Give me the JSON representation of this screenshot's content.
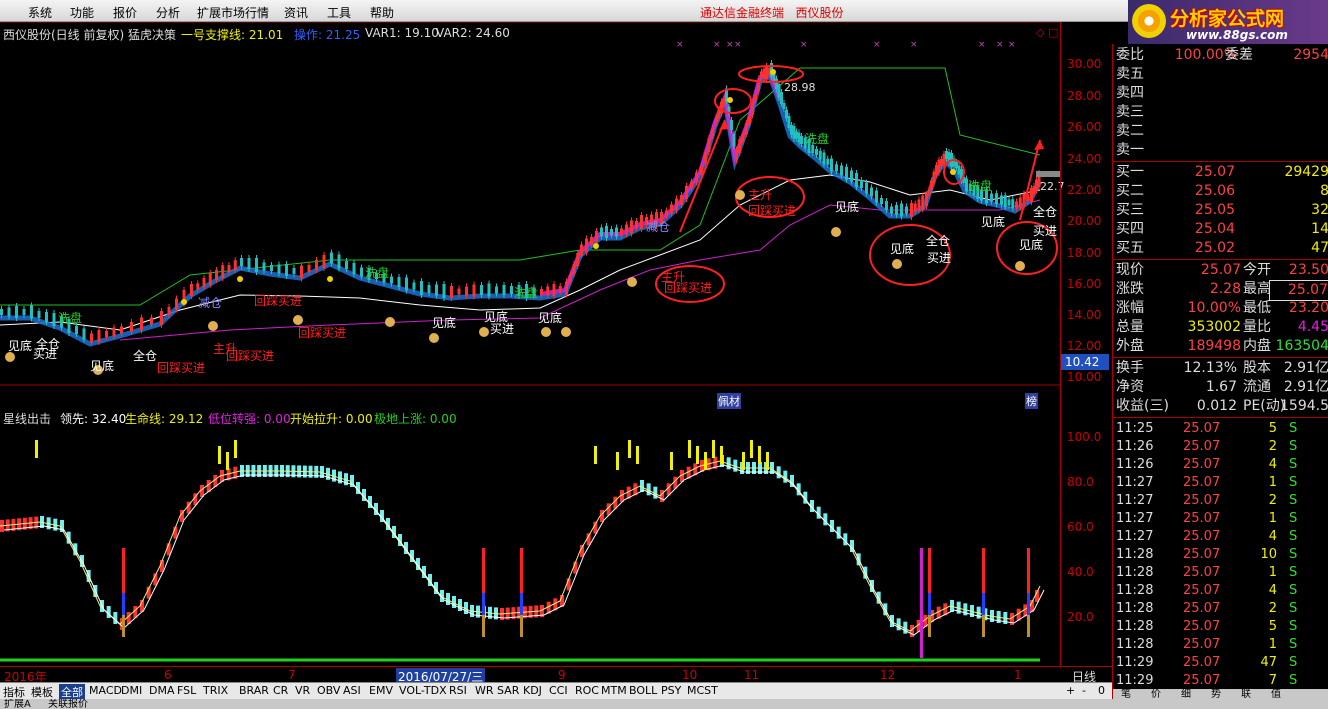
{
  "menu": [
    "系统",
    "功能",
    "报价",
    "分析",
    "扩展市场行情",
    "资讯",
    "工具",
    "帮助"
  ],
  "app_title": "通达信金融终端",
  "stock_name_header": "西仪股份",
  "brand": {
    "name": "分析家公式网",
    "url": "www.88gs.com"
  },
  "upper": {
    "title": "西仪股份(日线 前复权) 猛虎决策",
    "support_label": "一号支撑线: 21.01",
    "op_label": "操作: 21.25",
    "var1": "VAR1: 19.10",
    "var2": "VAR2: 24.60",
    "peak_label": "28.98",
    "right_tag": "22.7",
    "price_tag": "10.42",
    "marker1": "佩材",
    "marker2": "榜"
  },
  "lower": {
    "title": "星线出击",
    "l1": "领先: 32.40",
    "l2": "生命线: 29.12",
    "l3": "低位转强: 0.00",
    "l4": "开始拉升: 0.00",
    "l5": "极地上涨: 0.00"
  },
  "annotations": {
    "xipan": "洗盘",
    "jiandi": "见底",
    "quancang": "全仓",
    "mairu": "买进",
    "huicai": "回踩买进",
    "zhusheng": "主升",
    "jiancang": "减仓"
  },
  "upper_ticks": [
    "30.00",
    "28.00",
    "26.00",
    "24.00",
    "22.00",
    "20.00",
    "18.00",
    "16.00",
    "14.00",
    "12.00",
    "10.00"
  ],
  "lower_ticks": [
    "100.0",
    "80.0",
    "60.0",
    "40.0",
    "20.0"
  ],
  "dates": [
    "2016年",
    "6",
    "7",
    "2016/07/27/三",
    "9",
    "10",
    "11",
    "12",
    "1"
  ],
  "period": "日线",
  "tabs": [
    "指标",
    "模板",
    "全部",
    "MACD",
    "DMI",
    "DMA",
    "FSL",
    "TRIX",
    "BRAR",
    "CR",
    "VR",
    "OBV",
    "ASI",
    "EMV",
    "VOL-TDX",
    "RSI",
    "WR",
    "SAR",
    "KDJ",
    "CCI",
    "ROC",
    "MTM",
    "BOLL",
    "PSY",
    "MCST"
  ],
  "zoom_controls": [
    "+",
    "-",
    "0"
  ],
  "status_items": [
    "扩展A",
    "关联报价"
  ],
  "quote": {
    "top": {
      "label": "委比",
      "value": "100.00%",
      "label2": "委差",
      "value2": "2954"
    },
    "sells": [
      "卖五",
      "卖四",
      "卖三",
      "卖二",
      "卖一"
    ],
    "buys": [
      {
        "label": "买一",
        "price": "25.07",
        "vol": "29429"
      },
      {
        "label": "买二",
        "price": "25.06",
        "vol": "8"
      },
      {
        "label": "买三",
        "price": "25.05",
        "vol": "32"
      },
      {
        "label": "买四",
        "price": "25.04",
        "vol": "14"
      },
      {
        "label": "买五",
        "price": "25.02",
        "vol": "47"
      }
    ],
    "stats": [
      {
        "l": "现价",
        "v": "25.07",
        "l2": "今开",
        "v2": "23.50"
      },
      {
        "l": "涨跌",
        "v": "2.28",
        "l2": "最高",
        "v2": "25.07"
      },
      {
        "l": "涨幅",
        "v": "10.00%",
        "l2": "最低",
        "v2": "23.20"
      },
      {
        "l": "总量",
        "v": "353002",
        "l2": "量比",
        "v2": "4.45"
      },
      {
        "l": "外盘",
        "v": "189498",
        "l2": "内盘",
        "v2": "163504"
      }
    ],
    "stats2": [
      {
        "l": "换手",
        "v": "12.13%",
        "l2": "股本",
        "v2": "2.91亿"
      },
      {
        "l": "净资",
        "v": "1.67",
        "l2": "流通",
        "v2": "2.91亿"
      },
      {
        "l": "收益(三)",
        "v": "0.012",
        "l2": "PE(动)",
        "v2": "1594.5"
      }
    ],
    "ticks": [
      {
        "t": "11:25",
        "p": "25.07",
        "v": "5",
        "s": "S"
      },
      {
        "t": "11:26",
        "p": "25.07",
        "v": "2",
        "s": "S"
      },
      {
        "t": "11:26",
        "p": "25.07",
        "v": "4",
        "s": "S"
      },
      {
        "t": "11:27",
        "p": "25.07",
        "v": "1",
        "s": "S"
      },
      {
        "t": "11:27",
        "p": "25.07",
        "v": "2",
        "s": "S"
      },
      {
        "t": "11:27",
        "p": "25.07",
        "v": "1",
        "s": "S"
      },
      {
        "t": "11:27",
        "p": "25.07",
        "v": "4",
        "s": "S"
      },
      {
        "t": "11:28",
        "p": "25.07",
        "v": "10",
        "s": "S"
      },
      {
        "t": "11:28",
        "p": "25.07",
        "v": "1",
        "s": "S"
      },
      {
        "t": "11:28",
        "p": "25.07",
        "v": "4",
        "s": "S"
      },
      {
        "t": "11:28",
        "p": "25.07",
        "v": "2",
        "s": "S"
      },
      {
        "t": "11:28",
        "p": "25.07",
        "v": "5",
        "s": "S"
      },
      {
        "t": "11:28",
        "p": "25.07",
        "v": "1",
        "s": "S"
      },
      {
        "t": "11:29",
        "p": "25.07",
        "v": "47",
        "s": "S"
      },
      {
        "t": "11:29",
        "p": "25.07",
        "v": "7",
        "s": "S"
      }
    ],
    "footer_tabs": [
      "笔",
      "价",
      "细",
      "势",
      "联",
      "值"
    ]
  },
  "colors": {
    "up": "#ff3030",
    "down": "#20c0c0",
    "cyan_bar": "#6ef0f0",
    "blue_line": "#1e6fd0",
    "magenta": "#e020e0",
    "yellow": "#f0f000",
    "green": "#20d020",
    "circle": "#ff2020"
  }
}
